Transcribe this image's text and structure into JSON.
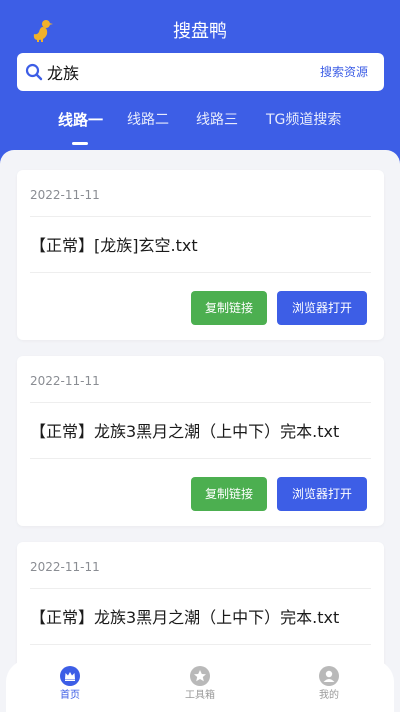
{
  "app": {
    "title": "搜盘鸭"
  },
  "search": {
    "value": "龙族",
    "button_label": "搜索资源"
  },
  "tabs": [
    {
      "label": "线路一",
      "active": true
    },
    {
      "label": "线路二",
      "active": false
    },
    {
      "label": "线路三",
      "active": false
    },
    {
      "label": "TG频道搜索",
      "active": false
    }
  ],
  "results": [
    {
      "date": "2022-11-11",
      "title": "【正常】[龙族]玄空.txt",
      "copy_label": "复制链接",
      "open_label": "浏览器打开"
    },
    {
      "date": "2022-11-11",
      "title": "【正常】龙族3黑月之潮（上中下）完本.txt",
      "copy_label": "复制链接",
      "open_label": "浏览器打开"
    },
    {
      "date": "2022-11-11",
      "title": "【正常】龙族3黑月之潮（上中下）完本.txt"
    }
  ],
  "bottom_nav": [
    {
      "label": "首页",
      "icon": "crown-icon",
      "active": true
    },
    {
      "label": "工具箱",
      "icon": "star-icon",
      "active": false
    },
    {
      "label": "我的",
      "icon": "user-icon",
      "active": false
    }
  ],
  "colors": {
    "primary": "#3d5ee6",
    "green": "#4caf50",
    "background": "#f3f4f8"
  }
}
